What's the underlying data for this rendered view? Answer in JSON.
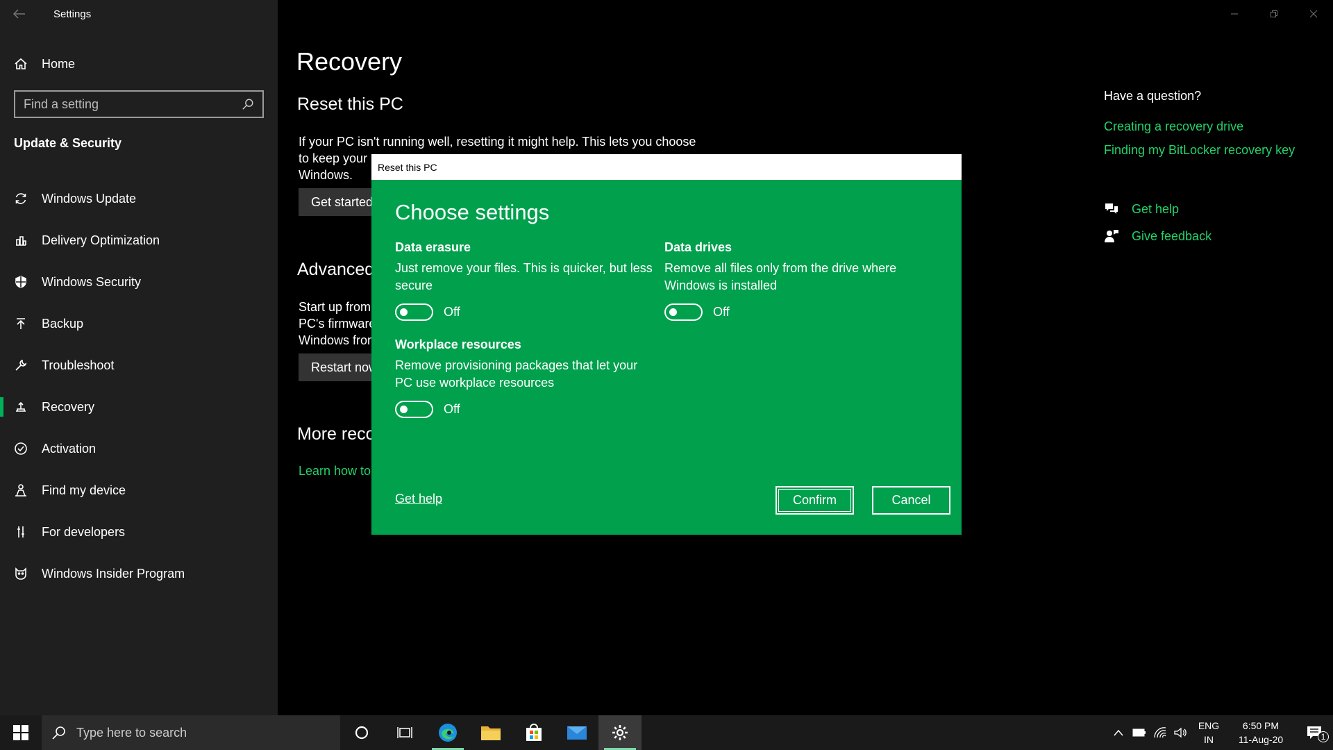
{
  "window": {
    "title": "Settings"
  },
  "sidebar": {
    "home_label": "Home",
    "search_placeholder": "Find a setting",
    "section_title": "Update & Security",
    "items": [
      {
        "label": "Windows Update",
        "icon": "sync-icon"
      },
      {
        "label": "Delivery Optimization",
        "icon": "delivery-icon"
      },
      {
        "label": "Windows Security",
        "icon": "shield-icon"
      },
      {
        "label": "Backup",
        "icon": "upload-arrow-icon"
      },
      {
        "label": "Troubleshoot",
        "icon": "wrench-icon"
      },
      {
        "label": "Recovery",
        "icon": "recovery-icon",
        "active": true
      },
      {
        "label": "Activation",
        "icon": "check-circle-icon"
      },
      {
        "label": "Find my device",
        "icon": "person-pin-icon"
      },
      {
        "label": "For developers",
        "icon": "developer-sliders-icon"
      },
      {
        "label": "Windows Insider Program",
        "icon": "insider-cat-icon"
      }
    ]
  },
  "main": {
    "page_title": "Recovery",
    "reset": {
      "heading": "Reset this PC",
      "line1": "If your PC isn't running well, resetting it might help. This lets you choose",
      "line2": "to keep your",
      "line3": "Windows.",
      "button": "Get started"
    },
    "advanced": {
      "heading": "Advanced",
      "line1": "Start up from",
      "line2": "PC's firmware",
      "line3": "Windows fron",
      "button": "Restart now"
    },
    "more": {
      "heading": "More reco",
      "link": "Learn how to"
    }
  },
  "right": {
    "question": "Have a question?",
    "links": [
      "Creating a recovery drive",
      "Finding my BitLocker recovery key"
    ],
    "get_help": "Get help",
    "give_feedback": "Give feedback"
  },
  "dialog": {
    "title": "Reset this PC",
    "heading": "Choose settings",
    "options": [
      {
        "title": "Data erasure",
        "desc1": "Just remove your files. This is quicker, but less",
        "desc2": "secure",
        "state": "Off"
      },
      {
        "title": "Data drives",
        "desc1": "Remove all files only from the drive where",
        "desc2": "Windows is installed",
        "state": "Off"
      },
      {
        "title": "Workplace resources",
        "desc1": "Remove provisioning packages that let your",
        "desc2": "PC use workplace resources",
        "state": "Off"
      }
    ],
    "get_help": "Get help",
    "confirm": "Confirm",
    "cancel": "Cancel"
  },
  "taskbar": {
    "search_placeholder": "Type here to search",
    "lang1": "ENG",
    "lang2": "IN",
    "time": "6:50 PM",
    "date": "11-Aug-20",
    "notification_count": "1"
  }
}
